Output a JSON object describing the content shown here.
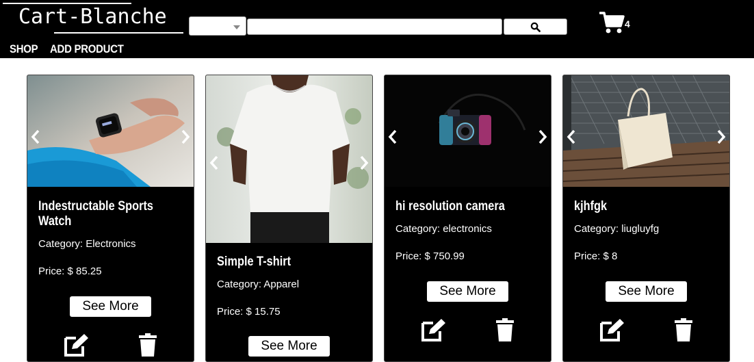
{
  "header": {
    "logo": "Cart-Blanche",
    "category_select": {
      "selected": ""
    },
    "search": {
      "value": "",
      "placeholder": ""
    },
    "cart": {
      "count": "4",
      "icon": "cart-icon"
    },
    "nav": [
      {
        "label": "SHOP"
      },
      {
        "label": "ADD PRODUCT"
      }
    ]
  },
  "products": [
    {
      "title_line1": "Indestructable Sports",
      "title_line2": "Watch",
      "category": "Category: Electronics",
      "price": "Price: $ 85.25",
      "button": "See More"
    },
    {
      "title_line1": "Simple T-shirt",
      "title_line2": "",
      "category": "Category: Apparel",
      "price": "Price: $ 15.75",
      "button": "See More"
    },
    {
      "title_line1": "hi resolution camera",
      "title_line2": "",
      "category": "Category: electronics",
      "price": "Price: $ 750.99",
      "button": "See More"
    },
    {
      "title_line1": "kjhfgk",
      "title_line2": "",
      "category": "Category: liugluyfg",
      "price": "Price: $ 8",
      "button": "See More"
    }
  ],
  "colors": {
    "header_bg": "#000000",
    "card_bg": "#000000",
    "text": "#ffffff",
    "button_bg": "#ffffff"
  }
}
